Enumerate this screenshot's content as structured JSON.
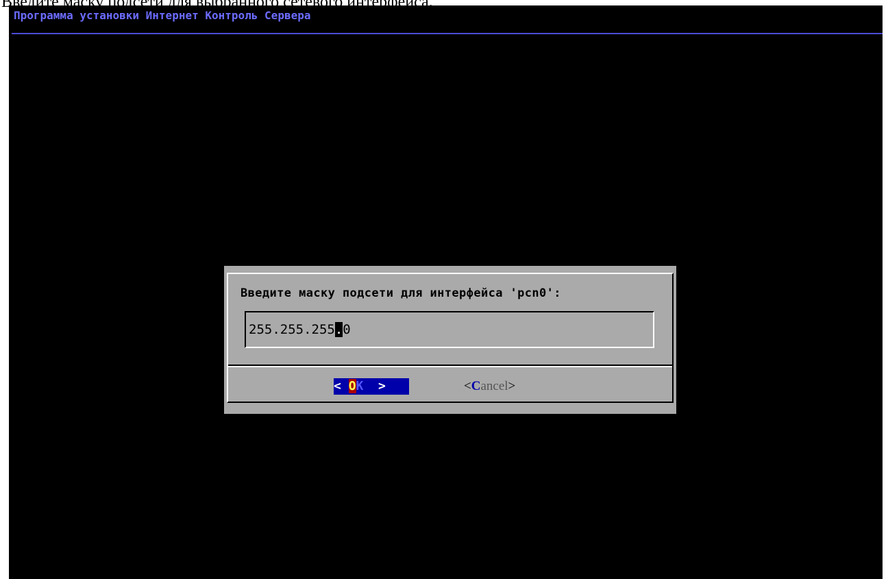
{
  "caption": "Введите маску подсети для выбранного сетевого интерфейса.",
  "installer": {
    "title": "Программа установки Интернет Контроль Сервера"
  },
  "dialog": {
    "prompt": "Введите маску подсети для интерфейса 'pcn0':",
    "input": {
      "value_before_cursor": "255.255.255",
      "cursor_char": ".",
      "value_after_cursor": "0"
    },
    "buttons": {
      "ok": {
        "open": "< ",
        "hotkey": "O",
        "rest": "K",
        "close": "  >"
      },
      "cancel": {
        "open": "<",
        "hotkey": "C",
        "rest": "ancel",
        "close": ">"
      }
    }
  },
  "colors": {
    "screen_bg": "#000000",
    "title": "#6b6bff",
    "dialog_bg": "#aaaaaa",
    "button_focus_bg": "#0000aa",
    "hotkey_bg": "#aa0000"
  }
}
